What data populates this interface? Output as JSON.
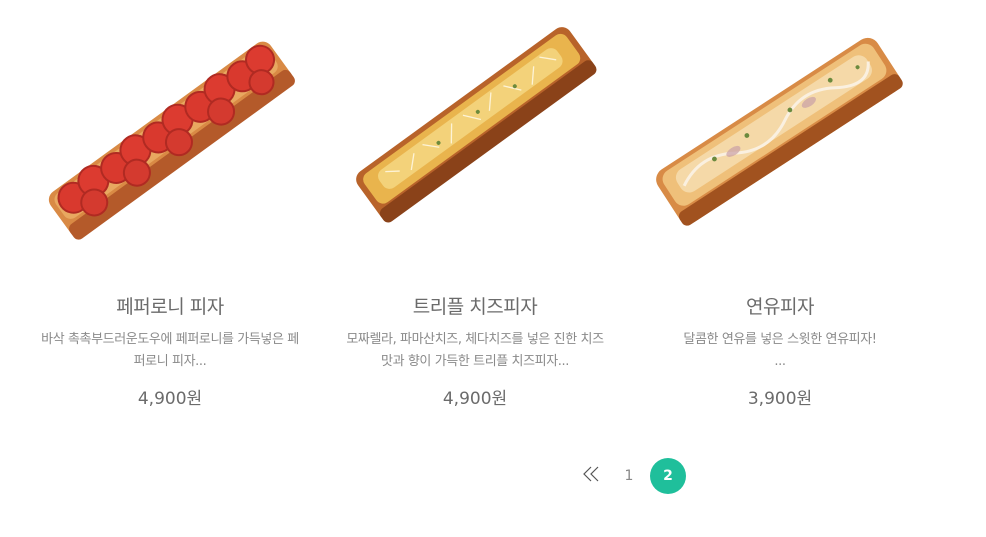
{
  "products": [
    {
      "name": "페퍼로니 피자",
      "description": "바삭 촉촉부드러운도우에 페퍼로니를 가득넣은 페\n퍼로니 피자...",
      "price": "4,900원",
      "image": "pepperoni-stick-pizza"
    },
    {
      "name": "트리플 치즈피자",
      "description": "모짜렐라, 파마산치즈, 체다치즈를 넣은 진한 치즈\n맛과 향이 가득한 트리플 치즈피자...",
      "price": "4,900원",
      "image": "triple-cheese-stick-pizza"
    },
    {
      "name": "연유피자",
      "description": "달콤한 연유를 넣은 스윗한 연유피자!\n...",
      "price": "3,900원",
      "image": "condensed-milk-stick-pizza"
    }
  ],
  "pagination": {
    "first_icon": "double-chevron-left-icon",
    "pages": [
      "1",
      "2"
    ],
    "current": "2"
  },
  "colors": {
    "accent": "#1fbf9b",
    "text": "#6b6b6b",
    "muted": "#8a8a8a"
  }
}
